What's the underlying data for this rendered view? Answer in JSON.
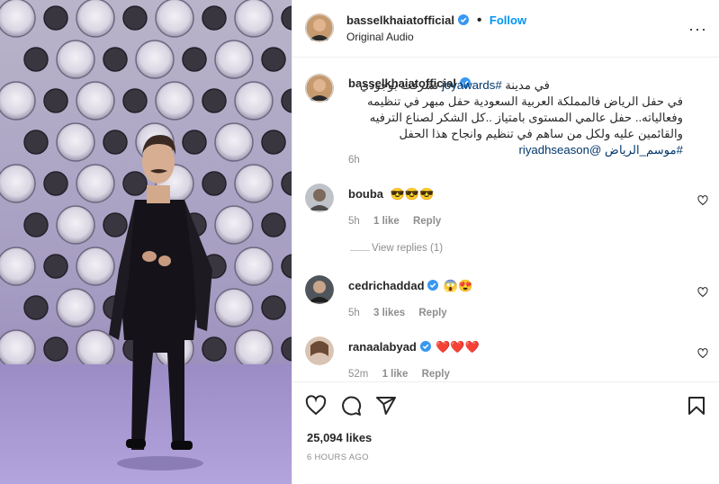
{
  "post": {
    "author": "basselkhaiatofficial",
    "dot": "•",
    "follow_label": "Follow",
    "audio": "Original Audio",
    "more": "···"
  },
  "caption": {
    "author": "basselkhaiatofficial",
    "text_1": "في مدينة ",
    "hashtag_1": "#joyawards",
    "text_2": " تشرفت بوجودي في حفل الرياض فالمملكة العربية السعودية حفل مبهر في تنظيمه وفعالياته.. حفل عالمي المستوى بامتياز ..كل الشكر لصناع الترفيه والقائمين عليه ولكل من ساهم في تنظيم وانجاح هذا الحفل ",
    "hashtag_2": "#موسم_الرياض",
    "mention": "@riyadhseason",
    "time": "6h"
  },
  "comments": [
    {
      "user": "bouba",
      "text": "😎😎😎",
      "time": "5h",
      "likes": "1 like",
      "reply": "Reply",
      "view_replies": "View replies (1)"
    },
    {
      "user": "cedrichaddad",
      "text": "😱😍",
      "time": "5h",
      "likes": "3 likes",
      "reply": "Reply"
    },
    {
      "user": "ranaalabyad",
      "text": "❤️❤️❤️",
      "time": "52m",
      "likes": "1 like",
      "reply": "Reply"
    }
  ],
  "footer": {
    "likes": "25,094 likes",
    "timeago": "6 HOURS AGO"
  },
  "icons": [
    "heart-icon",
    "comment-icon",
    "share-icon",
    "bookmark-icon",
    "verified-icon",
    "more-icon"
  ],
  "colors": {
    "accent": "#0095f6",
    "verified": "#3897f0",
    "heart": "#ed4956"
  }
}
